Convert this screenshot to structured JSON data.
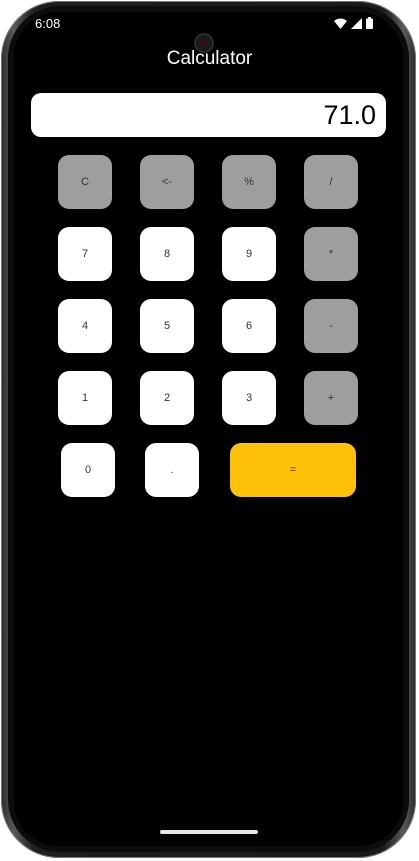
{
  "status_bar": {
    "time": "6:08"
  },
  "app": {
    "title": "Calculator"
  },
  "display": {
    "value": "71.0"
  },
  "keys": {
    "clear": "C",
    "backspace": "<-",
    "percent": "%",
    "divide": "/",
    "seven": "7",
    "eight": "8",
    "nine": "9",
    "multiply": "*",
    "four": "4",
    "five": "5",
    "six": "6",
    "subtract": "-",
    "one": "1",
    "two": "2",
    "three": "3",
    "add": "+",
    "zero": "0",
    "decimal": ".",
    "equals": "="
  },
  "colors": {
    "operator_key": "#9e9e9e",
    "number_key": "#ffffff",
    "equals_key": "#ffc107",
    "background": "#000000"
  }
}
